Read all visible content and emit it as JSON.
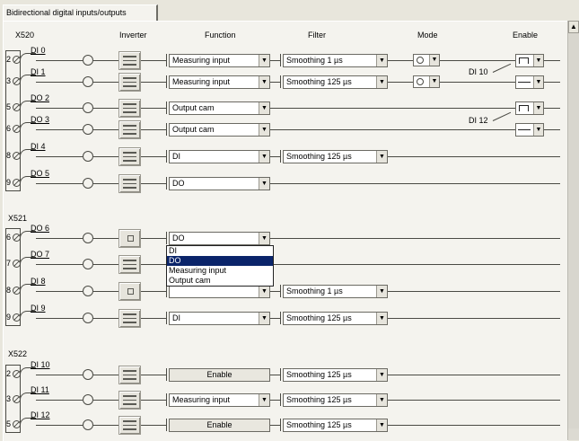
{
  "tab": {
    "label": "Bidirectional digital inputs/outputs"
  },
  "headers": {
    "terminal": "X520",
    "inverter": "Inverter",
    "function": "Function",
    "filter": "Filter",
    "mode": "Mode",
    "enable": "Enable"
  },
  "groups": [
    {
      "label": "X520"
    },
    {
      "label": "X521"
    },
    {
      "label": "X522"
    }
  ],
  "rows": [
    {
      "pin": "2",
      "signal": "DI 0",
      "function": "Measuring input",
      "filter": "Smoothing 1 µs",
      "mode": "visible",
      "enable": "pulse"
    },
    {
      "pin": "3",
      "signal": "DI 1",
      "function": "Measuring input",
      "filter": "Smoothing 125 µs",
      "mode": "visible",
      "enable": "flat"
    },
    {
      "pin": "5",
      "signal": "DO 2",
      "function": "Output cam",
      "filter": "",
      "mode": "",
      "enable": "pulse"
    },
    {
      "pin": "6",
      "signal": "DO 3",
      "function": "Output cam",
      "filter": "",
      "mode": "",
      "enable": "flat"
    },
    {
      "pin": "8",
      "signal": "DI 4",
      "function": "DI",
      "filter": "Smoothing 125 µs",
      "mode": "",
      "enable": ""
    },
    {
      "pin": "9",
      "signal": "DO 5",
      "function": "DO",
      "filter": "",
      "mode": "",
      "enable": ""
    },
    {
      "pin": "6",
      "signal": "DO 6",
      "function": "DO",
      "filter": "",
      "mode": "",
      "enable": ""
    },
    {
      "pin": "7",
      "signal": "DO 7",
      "function": "",
      "filter": "",
      "mode": "",
      "enable": ""
    },
    {
      "pin": "8",
      "signal": "DI 8",
      "function": "",
      "filter": "Smoothing 1 µs",
      "mode": "",
      "enable": ""
    },
    {
      "pin": "9",
      "signal": "DI 9",
      "function": "DI",
      "filter": "Smoothing 125 µs",
      "mode": "",
      "enable": ""
    },
    {
      "pin": "2",
      "signal": "DI 10",
      "function": "Enable",
      "filter": "Smoothing 125 µs",
      "mode": "",
      "enable": ""
    },
    {
      "pin": "3",
      "signal": "DI 11",
      "function": "Measuring input",
      "filter": "Smoothing 125 µs",
      "mode": "",
      "enable": ""
    },
    {
      "pin": "5",
      "signal": "DI 12",
      "function": "Enable",
      "filter": "Smoothing 125 µs",
      "mode": "",
      "enable": ""
    }
  ],
  "enable_source_labels": [
    "DI 10",
    "DI 12"
  ],
  "dropdown": {
    "options": [
      "DI",
      "DO",
      "Measuring input",
      "Output cam"
    ],
    "selected": "DO"
  },
  "icons": {
    "terminal": "terminal-contact-icon",
    "node": "connection-node-icon",
    "inverter": "inverter-toggle-icon",
    "mode": "edge-mode-icon",
    "enable_pulse": "pulse-enable-icon",
    "enable_flat": "flat-enable-icon",
    "arrow": "chevron-down-icon"
  },
  "colors": {
    "panel": "#f4f3ee",
    "window": "#e8e6dc",
    "selection": "#0a246a"
  }
}
